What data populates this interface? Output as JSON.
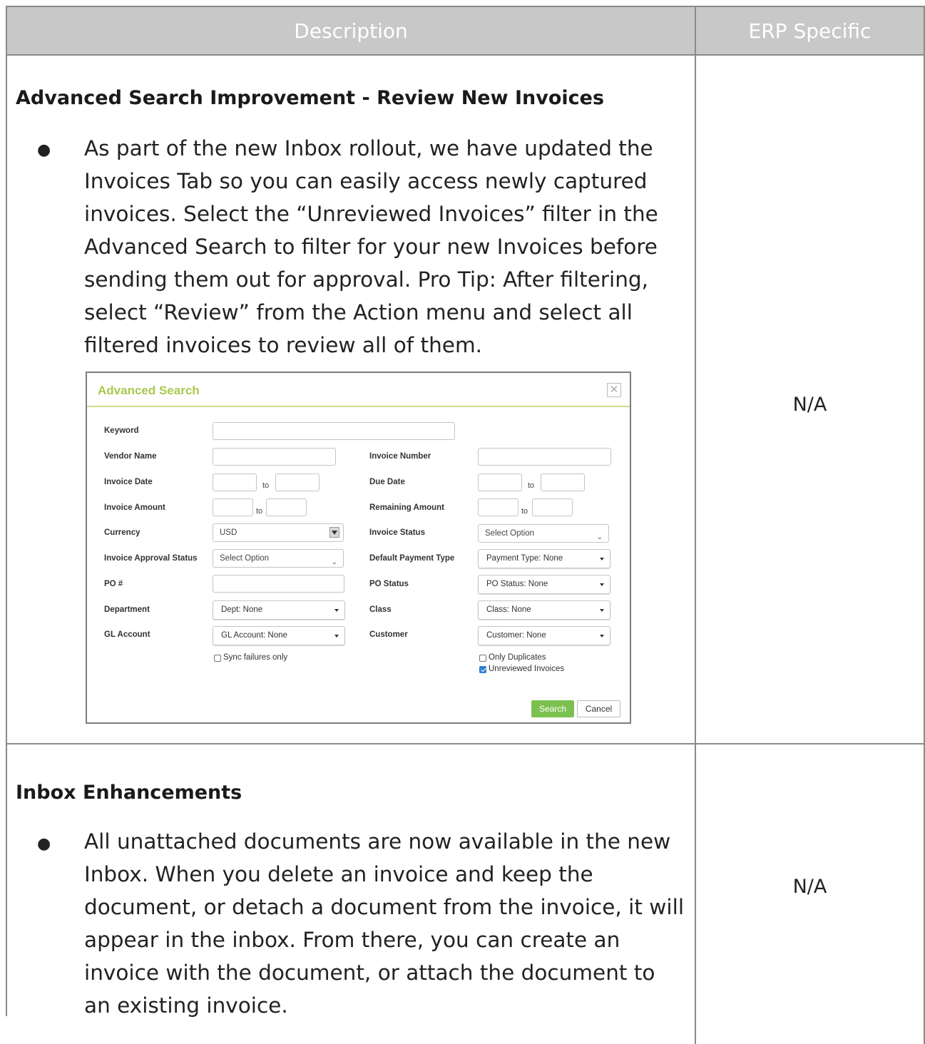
{
  "table": {
    "header": {
      "description": "Description",
      "erp_specific": "ERP Specific"
    },
    "rows": [
      {
        "title": "Advanced Search Improvement - Review New Invoices",
        "bullet": "●",
        "lines": [
          "As part of the new Inbox rollout, we have updated the",
          "Invoices Tab so you can easily access newly captured",
          "invoices. Select the “Unreviewed Invoices” filter in the",
          "Advanced Search to filter for your new Invoices before",
          "sending them out for approval. Pro Tip: After filtering,",
          "select “Review” from the Action menu and select all",
          "filtered invoices to review all of them."
        ],
        "erp": "N/A"
      },
      {
        "title": "Inbox Enhancements",
        "bullet": "●",
        "lines": [
          "All unattached documents are now available in the new",
          "Inbox. When you delete an invoice and keep the",
          "document, or detach a document from the invoice, it will",
          "appear in the inbox. From there, you can create an",
          "invoice with the document, or attach the document to",
          "an existing invoice."
        ],
        "erp": "N/A"
      }
    ]
  },
  "advanced_search": {
    "title": "Advanced Search",
    "close_icon": "close-icon",
    "labels": {
      "keyword": "Keyword",
      "vendor_name": "Vendor Name",
      "invoice_number": "Invoice Number",
      "invoice_date": "Invoice Date",
      "due_date": "Due Date",
      "invoice_amount": "Invoice Amount",
      "remaining_amount": "Remaining Amount",
      "currency": "Currency",
      "invoice_status": "Invoice Status",
      "invoice_approval_status": "Invoice Approval Status",
      "default_payment_type": "Default Payment Type",
      "po_number": "PO #",
      "po_status": "PO Status",
      "department": "Department",
      "class": "Class",
      "gl_account": "GL Account",
      "customer": "Customer"
    },
    "to": "to",
    "values": {
      "currency": "USD",
      "invoice_status": "Select Option",
      "invoice_approval_status": "Select Option",
      "default_payment_type": "Payment Type: None",
      "po_status": "PO Status: None",
      "department": "Dept: None",
      "class": "Class: None",
      "gl_account": "GL Account: None",
      "customer": "Customer: None"
    },
    "checkboxes": {
      "sync_failures_only": {
        "label": "Sync failures only",
        "checked": false
      },
      "only_duplicates": {
        "label": "Only Duplicates",
        "checked": false
      },
      "unreviewed_invoices": {
        "label": "Unreviewed Invoices",
        "checked": true
      }
    },
    "buttons": {
      "search": "Search",
      "cancel": "Cancel"
    },
    "colors": {
      "title": "#a9c84e",
      "search_button": "#7cc14f",
      "checkbox_checked": "#2f7fd6"
    }
  }
}
